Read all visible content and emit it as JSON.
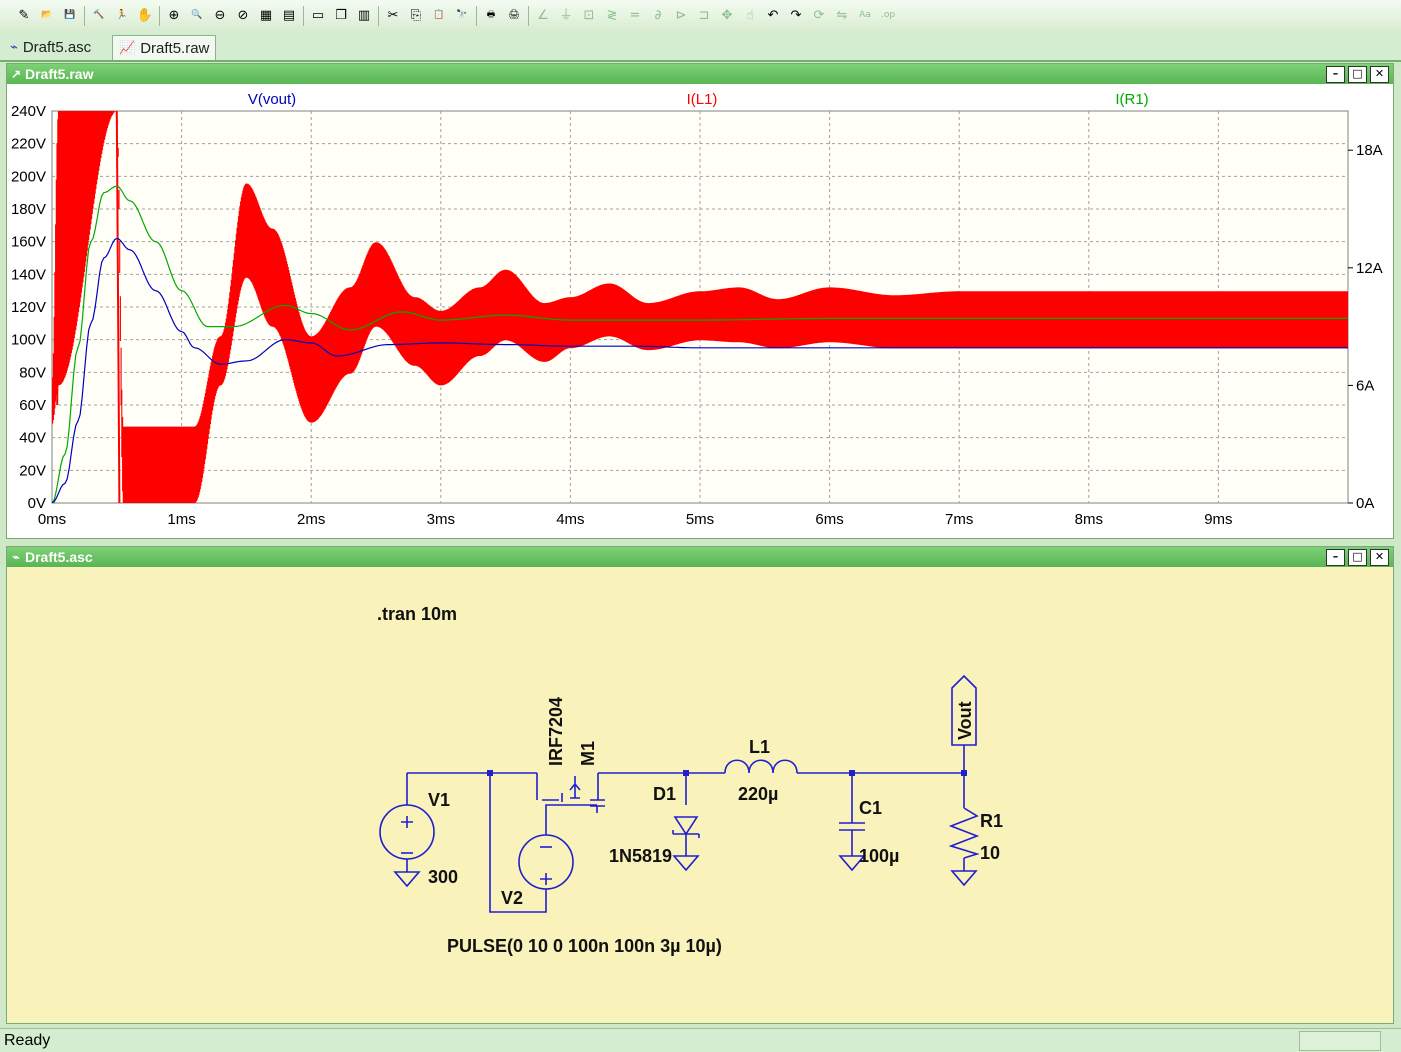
{
  "toolbar": {
    "icons": [
      "new-schematic-icon",
      "open-icon",
      "save-icon",
      "control-panel-icon",
      "run-icon",
      "halt-icon",
      "zoom-in-icon",
      "zoom-area-icon",
      "zoom-out-icon",
      "zoom-cancel-icon",
      "autorange-icon",
      "plot-settings-icon",
      "tile-horizontal-icon",
      "cascade-icon",
      "tile-vertical-icon",
      "cut-icon",
      "copy-icon",
      "paste-icon",
      "find-icon",
      "print-preview-icon",
      "print-icon",
      "wire-icon",
      "ground-icon",
      "label-net-icon",
      "resistor-icon",
      "capacitor-icon",
      "inductor-icon",
      "diode-icon",
      "component-icon",
      "move-icon",
      "drag-icon",
      "undo-icon",
      "redo-icon",
      "rotate-icon",
      "mirror-icon",
      "text-icon",
      "spice-directive-icon"
    ]
  },
  "tabs": [
    {
      "label": "Draft5.asc",
      "icon": "schematic-icon",
      "active": false
    },
    {
      "label": "Draft5.raw",
      "icon": "waveform-icon",
      "active": true
    }
  ],
  "waveform_window": {
    "title": "Draft5.raw",
    "traces": [
      {
        "label": "V(vout)",
        "color": "#0000c0"
      },
      {
        "label": "I(L1)",
        "color": "#ff0000"
      },
      {
        "label": "I(R1)",
        "color": "#00aa00"
      }
    ],
    "left_axis_ticks": [
      "240V",
      "220V",
      "200V",
      "180V",
      "160V",
      "140V",
      "120V",
      "100V",
      "80V",
      "60V",
      "40V",
      "20V",
      "0V"
    ],
    "right_axis_ticks": [
      "18A",
      "12A",
      "6A",
      "0A"
    ],
    "x_axis_ticks": [
      "0ms",
      "1ms",
      "2ms",
      "3ms",
      "4ms",
      "5ms",
      "6ms",
      "7ms",
      "8ms",
      "9ms"
    ]
  },
  "chart_data": {
    "type": "line",
    "xlabel": "",
    "ylabel": "",
    "xlim": [
      0,
      10
    ],
    "ylim_left": [
      0,
      240
    ],
    "ylim_right": [
      0,
      20
    ],
    "x_unit": "ms",
    "grid": true,
    "series": [
      {
        "name": "V(vout)",
        "axis": "left",
        "unit": "V",
        "x": [
          0,
          0.1,
          0.2,
          0.3,
          0.4,
          0.5,
          0.6,
          0.8,
          1.0,
          1.1,
          1.3,
          1.5,
          1.8,
          2.0,
          2.2,
          2.6,
          3.0,
          3.5,
          4.0,
          4.5,
          5.0,
          6.0,
          8.0,
          10.0
        ],
        "y": [
          0,
          12,
          50,
          110,
          150,
          162,
          155,
          130,
          105,
          95,
          85,
          87,
          100,
          98,
          90,
          97,
          98,
          97,
          96,
          96,
          95,
          95,
          95,
          95
        ]
      },
      {
        "name": "I(R1)",
        "axis": "left",
        "unit": "V",
        "x": [
          0,
          0.1,
          0.2,
          0.3,
          0.4,
          0.5,
          0.6,
          0.8,
          1.0,
          1.2,
          1.4,
          1.8,
          2.0,
          2.3,
          2.7,
          3.0,
          3.5,
          4.0,
          5.0,
          6.0,
          8.0,
          10.0
        ],
        "y": [
          0,
          30,
          95,
          160,
          190,
          194,
          185,
          160,
          130,
          108,
          108,
          121,
          116,
          106,
          117,
          112,
          115,
          112,
          112,
          113,
          113,
          113
        ]
      },
      {
        "name": "I(L1)",
        "axis": "right",
        "unit": "A",
        "envelope_upper": {
          "x": [
            0,
            0.05,
            0.5,
            0.55,
            1.1,
            1.3,
            1.5,
            1.7,
            2.0,
            2.3,
            2.5,
            2.8,
            3.0,
            3.3,
            3.5,
            3.8,
            4.0,
            4.3,
            4.6,
            5.0,
            5.3,
            5.6,
            6.0,
            6.5,
            7.0,
            10.0
          ],
          "y": [
            6,
            20,
            20,
            3.9,
            3.9,
            8.5,
            16.3,
            14,
            8.5,
            11,
            13.3,
            10.5,
            9.8,
            11,
            11.9,
            10.2,
            10.5,
            11.2,
            10.2,
            10.8,
            11,
            10.4,
            11,
            10.6,
            10.8,
            10.8
          ]
        },
        "envelope_lower": {
          "x": [
            0,
            0.05,
            0.5,
            0.55,
            1.1,
            1.3,
            1.5,
            1.7,
            2.0,
            2.3,
            2.5,
            2.8,
            3.0,
            3.3,
            3.5,
            3.8,
            4.0,
            4.3,
            4.6,
            5.0,
            5.3,
            5.6,
            6.0,
            6.5,
            7.0,
            10.0
          ],
          "y": [
            4,
            6,
            20,
            0,
            0,
            6,
            11.5,
            9,
            4.1,
            6.6,
            9,
            7,
            6,
            7.5,
            8.3,
            7.2,
            7.9,
            8.5,
            7.8,
            8.3,
            8.2,
            7.9,
            8.2,
            7.9,
            7.9,
            7.9
          ]
        }
      }
    ]
  },
  "schematic_window": {
    "title": "Draft5.asc",
    "directive": ".tran 10m",
    "components": {
      "v1_name": "V1",
      "v1_value": "300",
      "v2_name": "V2",
      "v2_value": "PULSE(0 10 0 100n 100n 3µ 10µ)",
      "m1_name": "M1",
      "m1_value": "IRF7204",
      "d1_name": "D1",
      "d1_value": "1N5819",
      "l1_name": "L1",
      "l1_value": "220µ",
      "c1_name": "C1",
      "c1_value": "100µ",
      "r1_name": "R1",
      "r1_value": "10",
      "out_label": "Vout"
    }
  },
  "status": {
    "text": "Ready"
  }
}
